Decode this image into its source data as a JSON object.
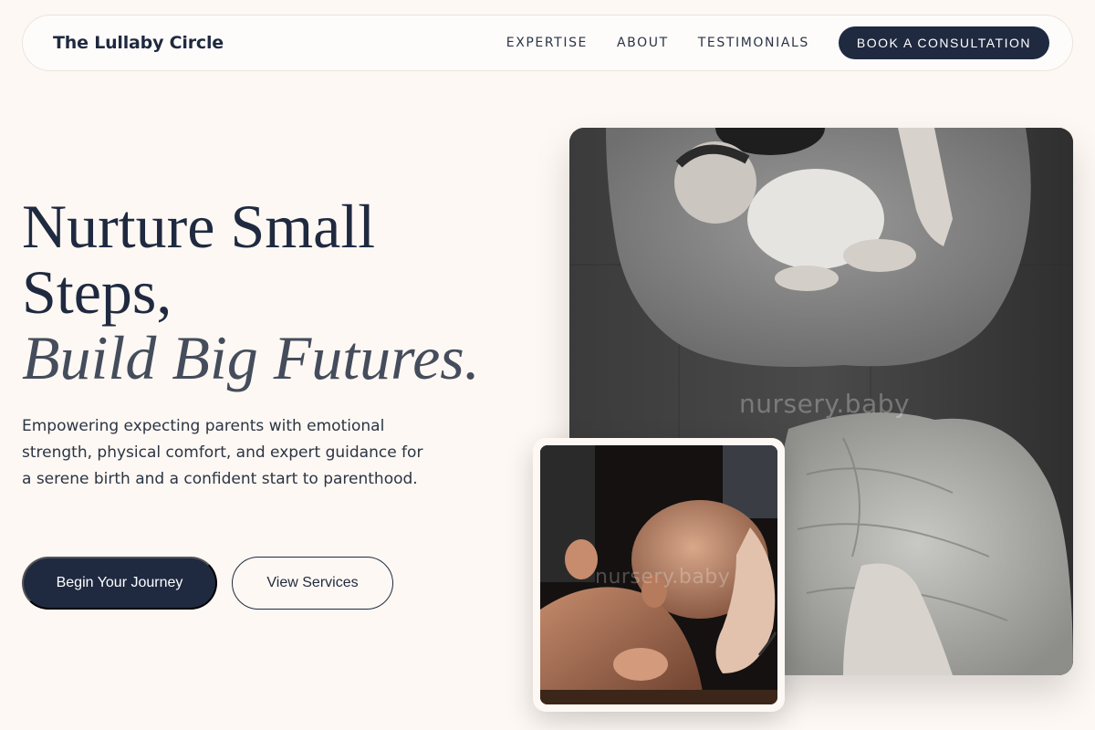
{
  "nav": {
    "brand": "The Lullaby Circle",
    "links": [
      "EXPERTISE",
      "ABOUT",
      "TESTIMONIALS"
    ],
    "cta": "BOOK A CONSULTATION"
  },
  "hero": {
    "headline_line1": "Nurture Small",
    "headline_line2": "Steps,",
    "headline_accent": "Build Big Futures.",
    "lede": "Empowering expecting parents with emotional strength, physical comfort, and expert guidance for a serene birth and a confident start to parenthood.",
    "primary_button": "Begin Your Journey",
    "secondary_button": "View Services"
  },
  "images": {
    "main_watermark": "nursery.baby",
    "small_watermark": "nursery.baby"
  },
  "colors": {
    "background": "#fdf8f3",
    "navy": "#1f2a40",
    "accent_text": "#454d5c"
  }
}
